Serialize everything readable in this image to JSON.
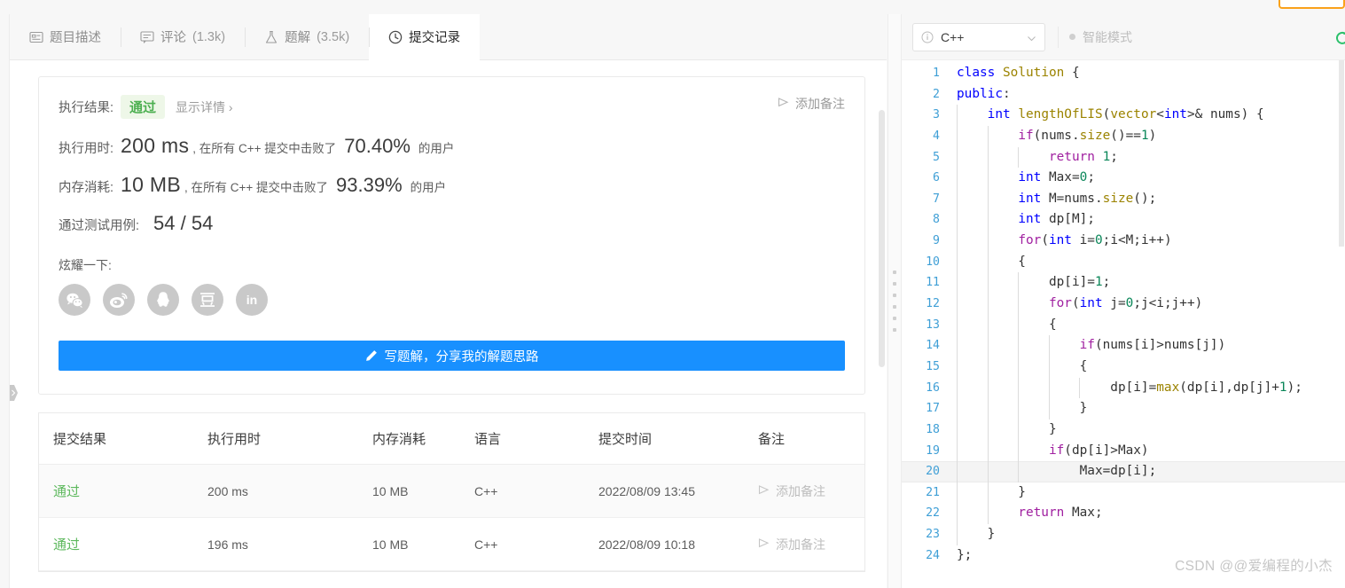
{
  "tabs": [
    {
      "label": "题目描述",
      "icon": "description-icon",
      "count": "",
      "active": false
    },
    {
      "label": "评论",
      "icon": "comment-icon",
      "count": "(1.3k)",
      "active": false
    },
    {
      "label": "题解",
      "icon": "flask-icon",
      "count": "(3.5k)",
      "active": false
    },
    {
      "label": "提交记录",
      "icon": "clock-icon",
      "count": "",
      "active": true
    }
  ],
  "result": {
    "result_label": "执行结果:",
    "verdict": "通过",
    "detail_link": "显示详情 ›",
    "add_note": "添加备注",
    "runtime_label": "执行用时:",
    "runtime_value": "200 ms",
    "runtime_mid": ", 在所有 C++ 提交中击败了",
    "runtime_pct": "70.40%",
    "runtime_suffix": "的用户",
    "memory_label": "内存消耗:",
    "memory_value": "10 MB",
    "memory_mid": ", 在所有 C++ 提交中击败了",
    "memory_pct": "93.39%",
    "memory_suffix": "的用户",
    "cases_label": "通过测试用例:",
    "cases_value": "54 / 54",
    "share_label": "炫耀一下:",
    "share_buttons": [
      {
        "name": "wechat-share-icon",
        "label": "微信"
      },
      {
        "name": "weibo-share-icon",
        "label": "微博"
      },
      {
        "name": "qq-share-icon",
        "label": "QQ"
      },
      {
        "name": "douban-share-icon",
        "label": "豆瓣"
      },
      {
        "name": "linkedin-share-icon",
        "label": "in"
      }
    ],
    "write_button": "写题解，分享我的解题思路"
  },
  "submissions": {
    "columns": [
      "提交结果",
      "执行用时",
      "内存消耗",
      "语言",
      "提交时间",
      "备注"
    ],
    "rows": [
      {
        "verdict": "通过",
        "runtime": "200 ms",
        "memory": "10 MB",
        "lang": "C++",
        "time": "2022/08/09 13:45",
        "note": "添加备注"
      },
      {
        "verdict": "通过",
        "runtime": "196 ms",
        "memory": "10 MB",
        "lang": "C++",
        "time": "2022/08/09 10:18",
        "note": "添加备注"
      }
    ]
  },
  "editor": {
    "language": "C++",
    "smart_mode": "智能模式",
    "watermark": "CSDN @@爱编程的小杰",
    "highlighted_line": 20,
    "code_lines": [
      {
        "n": 1,
        "indents": 0,
        "tokens": [
          {
            "t": "class",
            "c": "k"
          },
          {
            "t": " ",
            "c": "id"
          },
          {
            "t": "Solution",
            "c": "fn"
          },
          {
            "t": " {",
            "c": "id"
          }
        ]
      },
      {
        "n": 2,
        "indents": 0,
        "tokens": [
          {
            "t": "public",
            "c": "k"
          },
          {
            "t": ":",
            "c": "id"
          }
        ]
      },
      {
        "n": 3,
        "indents": 1,
        "tokens": [
          {
            "t": "    ",
            "c": "id"
          },
          {
            "t": "int",
            "c": "k"
          },
          {
            "t": " ",
            "c": "id"
          },
          {
            "t": "lengthOfLIS",
            "c": "fn"
          },
          {
            "t": "(",
            "c": "id"
          },
          {
            "t": "vector",
            "c": "fn"
          },
          {
            "t": "<",
            "c": "id"
          },
          {
            "t": "int",
            "c": "k"
          },
          {
            "t": ">& nums) {",
            "c": "id"
          }
        ]
      },
      {
        "n": 4,
        "indents": 2,
        "tokens": [
          {
            "t": "        ",
            "c": "id"
          },
          {
            "t": "if",
            "c": "ctl"
          },
          {
            "t": "(nums.",
            "c": "id"
          },
          {
            "t": "size",
            "c": "fn"
          },
          {
            "t": "()==",
            "c": "id"
          },
          {
            "t": "1",
            "c": "num"
          },
          {
            "t": ")",
            "c": "id"
          }
        ]
      },
      {
        "n": 5,
        "indents": 3,
        "tokens": [
          {
            "t": "            ",
            "c": "id"
          },
          {
            "t": "return",
            "c": "ctl"
          },
          {
            "t": " ",
            "c": "id"
          },
          {
            "t": "1",
            "c": "num"
          },
          {
            "t": ";",
            "c": "id"
          }
        ]
      },
      {
        "n": 6,
        "indents": 2,
        "tokens": [
          {
            "t": "        ",
            "c": "id"
          },
          {
            "t": "int",
            "c": "k"
          },
          {
            "t": " Max=",
            "c": "id"
          },
          {
            "t": "0",
            "c": "num"
          },
          {
            "t": ";",
            "c": "id"
          }
        ]
      },
      {
        "n": 7,
        "indents": 2,
        "tokens": [
          {
            "t": "        ",
            "c": "id"
          },
          {
            "t": "int",
            "c": "k"
          },
          {
            "t": " M=nums.",
            "c": "id"
          },
          {
            "t": "size",
            "c": "fn"
          },
          {
            "t": "();",
            "c": "id"
          }
        ]
      },
      {
        "n": 8,
        "indents": 2,
        "tokens": [
          {
            "t": "        ",
            "c": "id"
          },
          {
            "t": "int",
            "c": "k"
          },
          {
            "t": " dp[M];",
            "c": "id"
          }
        ]
      },
      {
        "n": 9,
        "indents": 2,
        "tokens": [
          {
            "t": "        ",
            "c": "id"
          },
          {
            "t": "for",
            "c": "ctl"
          },
          {
            "t": "(",
            "c": "id"
          },
          {
            "t": "int",
            "c": "k"
          },
          {
            "t": " i=",
            "c": "id"
          },
          {
            "t": "0",
            "c": "num"
          },
          {
            "t": ";i<M;i++)",
            "c": "id"
          }
        ]
      },
      {
        "n": 10,
        "indents": 2,
        "tokens": [
          {
            "t": "        {",
            "c": "id"
          }
        ]
      },
      {
        "n": 11,
        "indents": 3,
        "tokens": [
          {
            "t": "            dp[i]=",
            "c": "id"
          },
          {
            "t": "1",
            "c": "num"
          },
          {
            "t": ";",
            "c": "id"
          }
        ]
      },
      {
        "n": 12,
        "indents": 3,
        "tokens": [
          {
            "t": "            ",
            "c": "id"
          },
          {
            "t": "for",
            "c": "ctl"
          },
          {
            "t": "(",
            "c": "id"
          },
          {
            "t": "int",
            "c": "k"
          },
          {
            "t": " j=",
            "c": "id"
          },
          {
            "t": "0",
            "c": "num"
          },
          {
            "t": ";j<i;j++)",
            "c": "id"
          }
        ]
      },
      {
        "n": 13,
        "indents": 3,
        "tokens": [
          {
            "t": "            {",
            "c": "id"
          }
        ]
      },
      {
        "n": 14,
        "indents": 4,
        "tokens": [
          {
            "t": "                ",
            "c": "id"
          },
          {
            "t": "if",
            "c": "ctl"
          },
          {
            "t": "(nums[i]>nums[j])",
            "c": "id"
          }
        ]
      },
      {
        "n": 15,
        "indents": 4,
        "tokens": [
          {
            "t": "                {",
            "c": "id"
          }
        ]
      },
      {
        "n": 16,
        "indents": 5,
        "tokens": [
          {
            "t": "                    dp[i]=",
            "c": "id"
          },
          {
            "t": "max",
            "c": "fn"
          },
          {
            "t": "(dp[i],dp[j]+",
            "c": "id"
          },
          {
            "t": "1",
            "c": "num"
          },
          {
            "t": ");",
            "c": "id"
          }
        ]
      },
      {
        "n": 17,
        "indents": 4,
        "tokens": [
          {
            "t": "                }",
            "c": "id"
          }
        ]
      },
      {
        "n": 18,
        "indents": 3,
        "tokens": [
          {
            "t": "            }",
            "c": "id"
          }
        ]
      },
      {
        "n": 19,
        "indents": 3,
        "tokens": [
          {
            "t": "            ",
            "c": "id"
          },
          {
            "t": "if",
            "c": "ctl"
          },
          {
            "t": "(dp[i]>Max)",
            "c": "id"
          }
        ]
      },
      {
        "n": 20,
        "indents": 3,
        "tokens": [
          {
            "t": "                Max=dp[i];",
            "c": "id"
          }
        ]
      },
      {
        "n": 21,
        "indents": 2,
        "tokens": [
          {
            "t": "        }",
            "c": "id"
          }
        ]
      },
      {
        "n": 22,
        "indents": 2,
        "tokens": [
          {
            "t": "        ",
            "c": "id"
          },
          {
            "t": "return",
            "c": "ctl"
          },
          {
            "t": " Max;",
            "c": "id"
          }
        ]
      },
      {
        "n": 23,
        "indents": 1,
        "tokens": [
          {
            "t": "    }",
            "c": "id"
          }
        ]
      },
      {
        "n": 24,
        "indents": 0,
        "tokens": [
          {
            "t": "};",
            "c": "id"
          }
        ]
      }
    ]
  },
  "colors": {
    "accent_blue": "#1890ff",
    "success_green": "#5cb85c",
    "verdict_bg": "#eef7e8",
    "orange": "#faa21b",
    "reset_green": "#2cc06b"
  }
}
